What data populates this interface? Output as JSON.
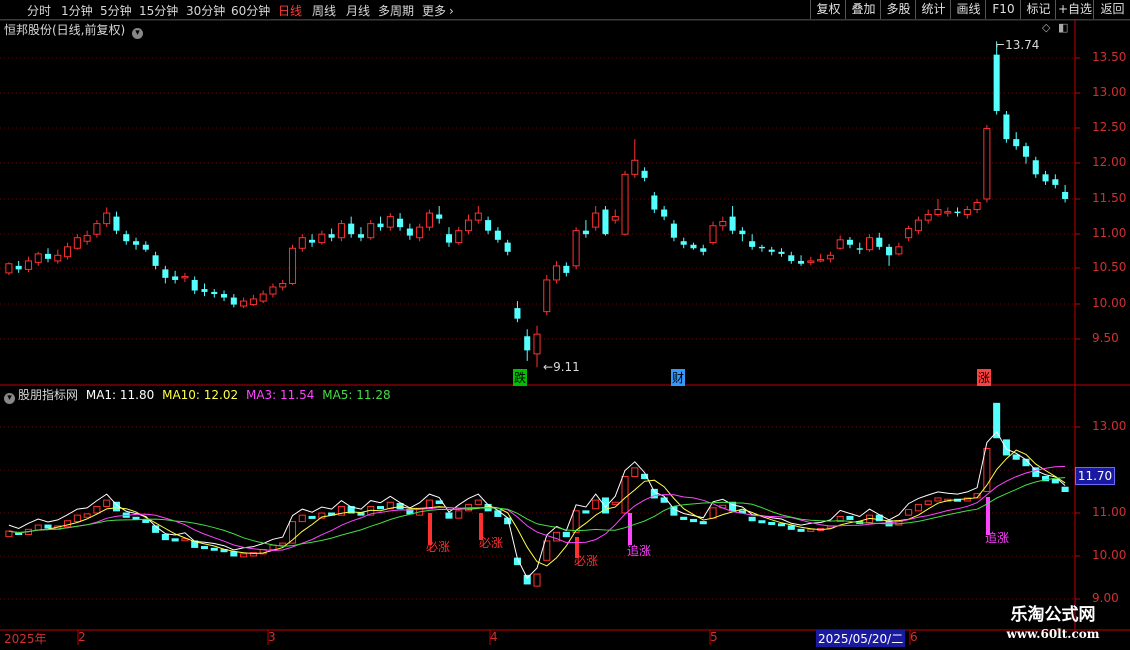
{
  "toolbar": {
    "periods": [
      "分时",
      "1分钟",
      "5分钟",
      "15分钟",
      "30分钟",
      "60分钟",
      "日线",
      "周线",
      "月线",
      "多周期",
      "更多"
    ],
    "more_arrow": "›",
    "active_period": "日线",
    "right_buttons": [
      "复权",
      "叠加",
      "多股",
      "统计",
      "画线",
      "F10",
      "标记",
      "+自选",
      "返回"
    ]
  },
  "main_panel": {
    "title": "恒邦股份(日线,前复权)",
    "high_label": "13.74",
    "low_label": "9.11",
    "y_ticks": [
      "13.50",
      "13.00",
      "12.50",
      "12.00",
      "11.50",
      "11.00",
      "10.50",
      "10.00",
      "9.50"
    ],
    "markers": [
      {
        "text": "跌",
        "color": "#00d000"
      },
      {
        "text": "财",
        "color": "#4aa8ff"
      },
      {
        "text": "涨",
        "color": "#ff4040"
      }
    ]
  },
  "indicator_panel": {
    "title": "股朋指标网",
    "ma1": {
      "label": "MA1: 11.80",
      "color": "#ffffff"
    },
    "ma10": {
      "label": "MA10: 12.02",
      "color": "#ffff44"
    },
    "ma3": {
      "label": "MA3: 11.54",
      "color": "#ff44ff"
    },
    "ma5": {
      "label": "MA5: 11.28",
      "color": "#44dd44"
    },
    "y_ticks": [
      "13.00",
      "11.00",
      "10.00",
      "9.00"
    ],
    "current_value": "11.70",
    "signals": [
      {
        "text": "必涨",
        "color": "#ff3030"
      },
      {
        "text": "必涨",
        "color": "#ff3030"
      },
      {
        "text": "必涨",
        "color": "#ff3030"
      },
      {
        "text": "追涨",
        "color": "#ff44ff"
      },
      {
        "text": "追涨",
        "color": "#ff44ff"
      }
    ]
  },
  "time_axis": {
    "labels": [
      "2025年",
      "2",
      "3",
      "4",
      "5",
      "2025/05/20/二",
      "6"
    ]
  },
  "watermark": {
    "title": "乐淘公式网",
    "url": "www.60lt.com"
  },
  "colors": {
    "up": "#ff3030",
    "down": "#54ffff",
    "grid": "#700000",
    "axis": "#c00000"
  },
  "chart_data": {
    "type": "candlestick",
    "y_range": [
      9.0,
      13.9
    ],
    "candles": [
      [
        10.45,
        10.58,
        10.6,
        10.42
      ],
      [
        10.55,
        10.5,
        10.62,
        10.45
      ],
      [
        10.5,
        10.62,
        10.68,
        10.46
      ],
      [
        10.6,
        10.72,
        10.75,
        10.55
      ],
      [
        10.72,
        10.65,
        10.8,
        10.6
      ],
      [
        10.62,
        10.7,
        10.78,
        10.58
      ],
      [
        10.68,
        10.82,
        10.88,
        10.64
      ],
      [
        10.8,
        10.95,
        11.0,
        10.78
      ],
      [
        10.9,
        10.98,
        11.05,
        10.85
      ],
      [
        11.0,
        11.15,
        11.2,
        10.95
      ],
      [
        11.15,
        11.3,
        11.38,
        11.1
      ],
      [
        11.25,
        11.05,
        11.32,
        11.0
      ],
      [
        11.0,
        10.9,
        11.05,
        10.85
      ],
      [
        10.9,
        10.85,
        10.95,
        10.78
      ],
      [
        10.85,
        10.78,
        10.9,
        10.75
      ],
      [
        10.7,
        10.55,
        10.75,
        10.5
      ],
      [
        10.5,
        10.38,
        10.55,
        10.3
      ],
      [
        10.4,
        10.35,
        10.48,
        10.3
      ],
      [
        10.38,
        10.4,
        10.45,
        10.32
      ],
      [
        10.35,
        10.2,
        10.4,
        10.15
      ],
      [
        10.22,
        10.18,
        10.3,
        10.12
      ],
      [
        10.18,
        10.15,
        10.22,
        10.1
      ],
      [
        10.15,
        10.1,
        10.2,
        10.05
      ],
      [
        10.1,
        10.0,
        10.15,
        9.96
      ],
      [
        9.98,
        10.05,
        10.1,
        9.95
      ],
      [
        10.0,
        10.08,
        10.14,
        9.98
      ],
      [
        10.05,
        10.15,
        10.2,
        10.02
      ],
      [
        10.15,
        10.25,
        10.3,
        10.1
      ],
      [
        10.25,
        10.3,
        10.35,
        10.2
      ],
      [
        10.3,
        10.8,
        10.85,
        10.28
      ],
      [
        10.8,
        10.95,
        11.0,
        10.75
      ],
      [
        10.92,
        10.88,
        11.0,
        10.82
      ],
      [
        10.88,
        11.0,
        11.05,
        10.85
      ],
      [
        11.0,
        10.95,
        11.08,
        10.9
      ],
      [
        10.95,
        11.15,
        11.2,
        10.9
      ],
      [
        11.15,
        11.0,
        11.25,
        10.95
      ],
      [
        11.0,
        10.95,
        11.1,
        10.9
      ],
      [
        10.95,
        11.15,
        11.2,
        10.92
      ],
      [
        11.15,
        11.1,
        11.25,
        11.05
      ],
      [
        11.1,
        11.25,
        11.3,
        11.05
      ],
      [
        11.22,
        11.1,
        11.3,
        11.05
      ],
      [
        11.08,
        10.98,
        11.15,
        10.92
      ],
      [
        10.95,
        11.1,
        11.15,
        10.9
      ],
      [
        11.1,
        11.3,
        11.35,
        11.05
      ],
      [
        11.28,
        11.22,
        11.4,
        11.15
      ],
      [
        11.0,
        10.88,
        11.1,
        10.82
      ],
      [
        10.88,
        11.05,
        11.1,
        10.85
      ],
      [
        11.05,
        11.2,
        11.28,
        11.0
      ],
      [
        11.2,
        11.3,
        11.4,
        11.15
      ],
      [
        11.2,
        11.05,
        11.25,
        11.0
      ],
      [
        11.05,
        10.92,
        11.1,
        10.88
      ],
      [
        10.88,
        10.75,
        10.92,
        10.7
      ],
      [
        9.95,
        9.8,
        10.05,
        9.75
      ],
      [
        9.55,
        9.35,
        9.65,
        9.2
      ],
      [
        9.3,
        9.58,
        9.7,
        9.11
      ],
      [
        9.9,
        10.35,
        10.42,
        9.85
      ],
      [
        10.35,
        10.55,
        10.62,
        10.3
      ],
      [
        10.55,
        10.45,
        10.6,
        10.4
      ],
      [
        10.55,
        11.05,
        11.1,
        10.5
      ],
      [
        11.05,
        11.0,
        11.2,
        10.95
      ],
      [
        11.1,
        11.3,
        11.4,
        11.05
      ],
      [
        11.35,
        11.0,
        11.4,
        10.98
      ],
      [
        11.2,
        11.25,
        11.35,
        11.15
      ],
      [
        11.0,
        11.85,
        11.9,
        10.98
      ],
      [
        11.85,
        12.05,
        12.35,
        11.8
      ],
      [
        11.9,
        11.8,
        11.95,
        11.75
      ],
      [
        11.55,
        11.35,
        11.6,
        11.3
      ],
      [
        11.35,
        11.25,
        11.4,
        11.2
      ],
      [
        11.15,
        10.95,
        11.2,
        10.9
      ],
      [
        10.9,
        10.85,
        10.95,
        10.8
      ],
      [
        10.85,
        10.8,
        10.88,
        10.78
      ],
      [
        10.8,
        10.75,
        10.85,
        10.7
      ],
      [
        10.88,
        11.12,
        11.18,
        10.85
      ],
      [
        11.12,
        11.18,
        11.25,
        11.05
      ],
      [
        11.25,
        11.05,
        11.4,
        11.0
      ],
      [
        11.05,
        11.0,
        11.1,
        10.9
      ],
      [
        10.9,
        10.82,
        11.0,
        10.78
      ],
      [
        10.82,
        10.8,
        10.85,
        10.75
      ],
      [
        10.78,
        10.75,
        10.82,
        10.7
      ],
      [
        10.75,
        10.72,
        10.8,
        10.68
      ],
      [
        10.7,
        10.62,
        10.75,
        10.58
      ],
      [
        10.62,
        10.58,
        10.7,
        10.55
      ],
      [
        10.6,
        10.62,
        10.68,
        10.56
      ],
      [
        10.62,
        10.64,
        10.72,
        10.6
      ],
      [
        10.65,
        10.7,
        10.75,
        10.6
      ],
      [
        10.8,
        10.92,
        10.98,
        10.78
      ],
      [
        10.92,
        10.85,
        10.96,
        10.8
      ],
      [
        10.8,
        10.78,
        10.88,
        10.72
      ],
      [
        10.78,
        10.95,
        11.0,
        10.75
      ],
      [
        10.95,
        10.82,
        11.02,
        10.78
      ],
      [
        10.82,
        10.7,
        10.86,
        10.55
      ],
      [
        10.72,
        10.82,
        10.88,
        10.7
      ],
      [
        10.95,
        11.08,
        11.12,
        10.9
      ],
      [
        11.05,
        11.2,
        11.25,
        11.0
      ],
      [
        11.2,
        11.28,
        11.35,
        11.15
      ],
      [
        11.28,
        11.35,
        11.5,
        11.25
      ],
      [
        11.3,
        11.32,
        11.38,
        11.25
      ],
      [
        11.32,
        11.3,
        11.38,
        11.25
      ],
      [
        11.28,
        11.35,
        11.4,
        11.22
      ],
      [
        11.35,
        11.45,
        11.5,
        11.3
      ],
      [
        11.5,
        12.5,
        12.55,
        11.45
      ],
      [
        13.55,
        12.75,
        13.74,
        12.7
      ],
      [
        12.7,
        12.35,
        12.75,
        12.3
      ],
      [
        12.35,
        12.25,
        12.45,
        12.2
      ],
      [
        12.25,
        12.1,
        12.3,
        12.0
      ],
      [
        12.05,
        11.85,
        12.1,
        11.8
      ],
      [
        11.85,
        11.75,
        11.9,
        11.7
      ],
      [
        11.78,
        11.7,
        11.85,
        11.65
      ],
      [
        11.6,
        11.5,
        11.7,
        11.45
      ]
    ]
  }
}
